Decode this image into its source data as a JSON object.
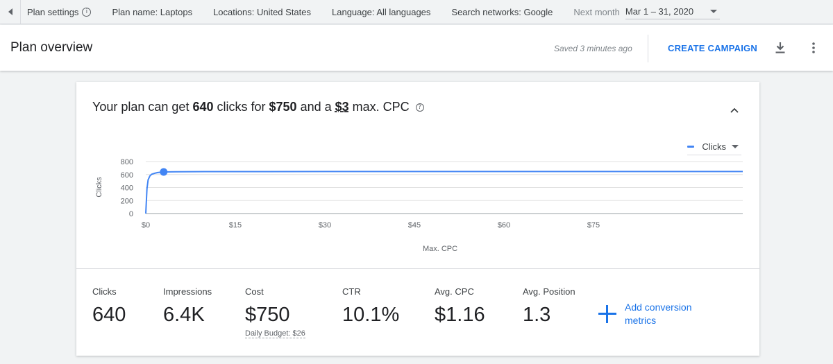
{
  "topbar": {
    "plan_settings": "Plan settings",
    "plan_name": "Plan name: Laptops",
    "locations": "Locations: United States",
    "language": "Language: All languages",
    "networks": "Search networks: Google",
    "date_label": "Next month",
    "date_value": "Mar 1 – 31, 2020"
  },
  "header": {
    "title": "Plan overview",
    "saved": "Saved 3 minutes ago",
    "create_campaign": "CREATE CAMPAIGN"
  },
  "card": {
    "headline": {
      "pre": "Your plan can get ",
      "clicks": "640",
      "mid1": " clicks for ",
      "cost": "$750",
      "mid2": " and a ",
      "cpc": "$3",
      "post": " max. CPC"
    },
    "legend": "Clicks",
    "metrics": [
      {
        "label": "Clicks",
        "value": "640"
      },
      {
        "label": "Impressions",
        "value": "6.4K"
      },
      {
        "label": "Cost",
        "value": "$750",
        "sub": "Daily Budget: $26"
      },
      {
        "label": "CTR",
        "value": "10.1%"
      },
      {
        "label": "Avg. CPC",
        "value": "$1.16"
      },
      {
        "label": "Avg. Position",
        "value": "1.3"
      }
    ],
    "add_conversion": "Add conversion metrics"
  },
  "chart_data": {
    "type": "line",
    "xlabel": "Max. CPC",
    "ylabel": "Clicks",
    "xlim": [
      0,
      100
    ],
    "ylim": [
      0,
      800
    ],
    "x_ticks": [
      0,
      15,
      30,
      45,
      60,
      75
    ],
    "x_tick_labels": [
      "$0",
      "$15",
      "$30",
      "$45",
      "$60",
      "$75"
    ],
    "y_ticks": [
      0,
      200,
      400,
      600,
      800
    ],
    "y_tick_labels": [
      "0",
      "200",
      "400",
      "600",
      "800"
    ],
    "series": [
      {
        "name": "Clicks",
        "color": "#4285f4",
        "x": [
          0,
          0.2,
          0.4,
          0.7,
          1.0,
          1.5,
          2.0,
          3.0,
          5,
          10,
          30,
          60,
          100
        ],
        "y": [
          0,
          380,
          520,
          580,
          605,
          620,
          630,
          640,
          643,
          645,
          646,
          646,
          646
        ]
      }
    ],
    "highlight": {
      "x": 3,
      "y": 640
    },
    "grid": true
  }
}
